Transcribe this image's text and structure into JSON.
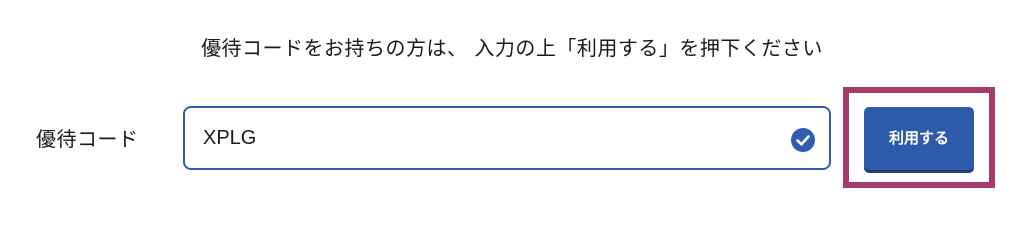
{
  "instruction_text": "優待コードをお持ちの方は、 入力の上「利用する」を押下ください",
  "coupon_form": {
    "label": "優待コード",
    "input_value": "XPLG",
    "submit_label": "利用する"
  },
  "colors": {
    "input_border": "#2f5db3",
    "button_bg": "#2d5ba9",
    "highlight_frame": "#a53b6b",
    "check_icon": "#2f5db3"
  },
  "icons": {
    "valid_status": "check-circle-icon"
  }
}
